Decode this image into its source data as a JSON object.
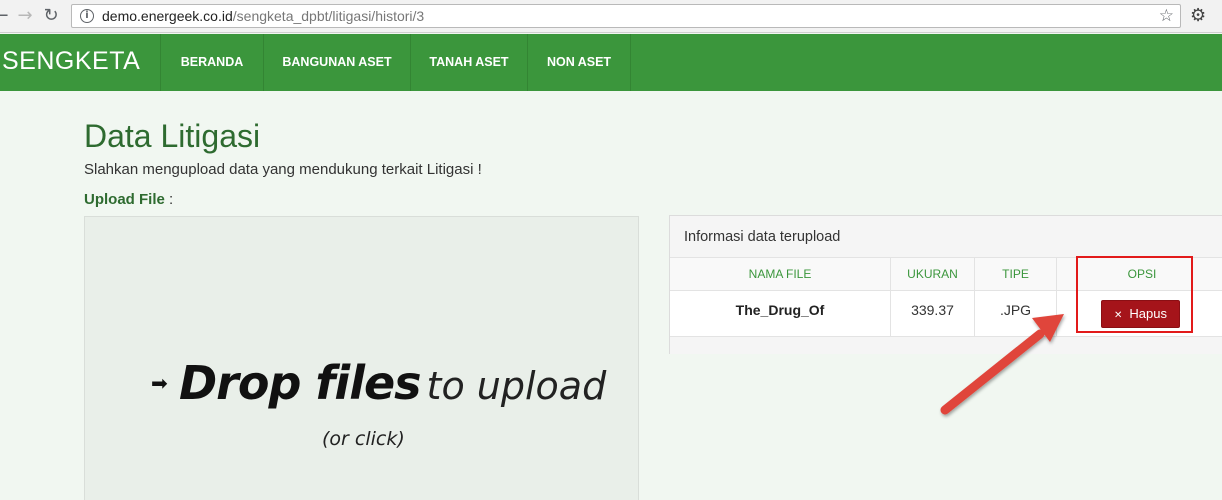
{
  "browser": {
    "url_host": "demo.energeek.co.id",
    "url_path": "/sengketa_dpbt/litigasi/histori/3",
    "icons": [
      "back-icon",
      "forward-icon",
      "reload-icon",
      "info-icon",
      "star-icon",
      "gear-icon"
    ]
  },
  "navbar": {
    "brand": "SENGKETA",
    "items": [
      {
        "label": "BERANDA"
      },
      {
        "label": "BANGUNAN ASET"
      },
      {
        "label": "TANAH ASET"
      },
      {
        "label": "NON ASET"
      }
    ],
    "color": "#3b963c"
  },
  "page": {
    "title": "Data Litigasi",
    "subtitle": "Slahkan mengupload data yang mendukung terkait Litigasi !",
    "upload_label": "Upload File",
    "upload_colon": ":"
  },
  "dropzone": {
    "bold_text": "Drop files",
    "light_text": "to upload",
    "sub_text": "(or click)"
  },
  "panel": {
    "heading": "Informasi data terupload",
    "columns": [
      "NAMA FILE",
      "UKURAN",
      "TIPE",
      "OPSI"
    ],
    "rows": [
      {
        "nama_file": "The_Drug_Of",
        "ukuran": "339.37",
        "tipe": ".JPG",
        "action": "Hapus"
      }
    ]
  },
  "colors": {
    "accent": "#3b963c",
    "title": "#2e6b30",
    "danger": "#a5141a",
    "annotation": "#e21a1a"
  }
}
